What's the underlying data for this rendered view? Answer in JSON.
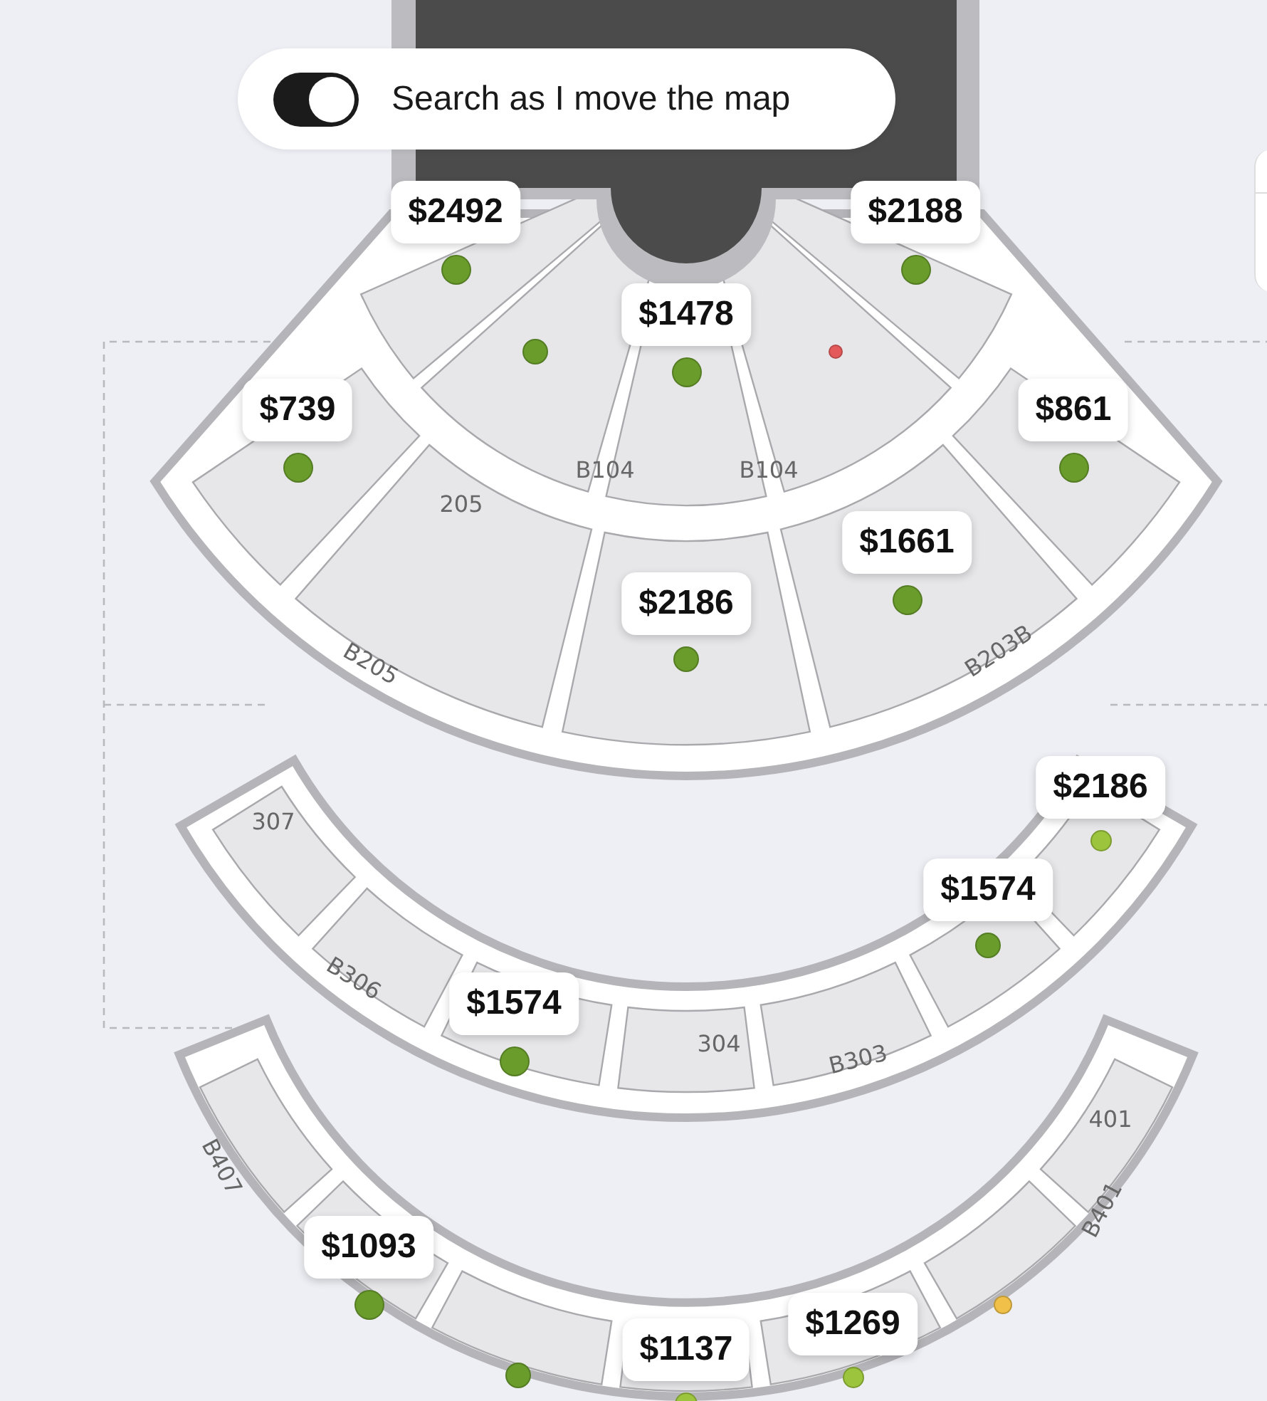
{
  "map_toggle": {
    "label": "Search as I move the map",
    "on": true
  },
  "price_pins": [
    {
      "price": "$2492",
      "color": "#6a9c2c"
    },
    {
      "price": "$2188",
      "color": "#6a9c2c"
    },
    {
      "price": "$1478",
      "color": "#6a9c2c"
    },
    {
      "price": "$739",
      "color": "#6a9c2c"
    },
    {
      "price": "$861",
      "color": "#6a9c2c"
    },
    {
      "price": "$1661",
      "color": "#6a9c2c"
    },
    {
      "price": "$2186",
      "color": "#6a9c2c"
    },
    {
      "price": "$2186",
      "color": "#9cc43c"
    },
    {
      "price": "$1574",
      "color": "#6a9c2c"
    },
    {
      "price": "$1574",
      "color": "#6a9c2c"
    },
    {
      "price": "$1093",
      "color": "#6a9c2c"
    },
    {
      "price": "$1137",
      "color": "#9cc43c"
    },
    {
      "price": "$1269",
      "color": "#9cc43c"
    }
  ],
  "markers": [
    {
      "color": "#6a9c2c"
    },
    {
      "color": "#e45a5a"
    },
    {
      "color": "#6a9c2c"
    },
    {
      "color": "#f0c048"
    }
  ],
  "section_labels": [
    "B104",
    "B104",
    "205",
    "B205",
    "B203B",
    "307",
    "B306",
    "304",
    "B303",
    "401",
    "B401",
    "B407"
  ]
}
